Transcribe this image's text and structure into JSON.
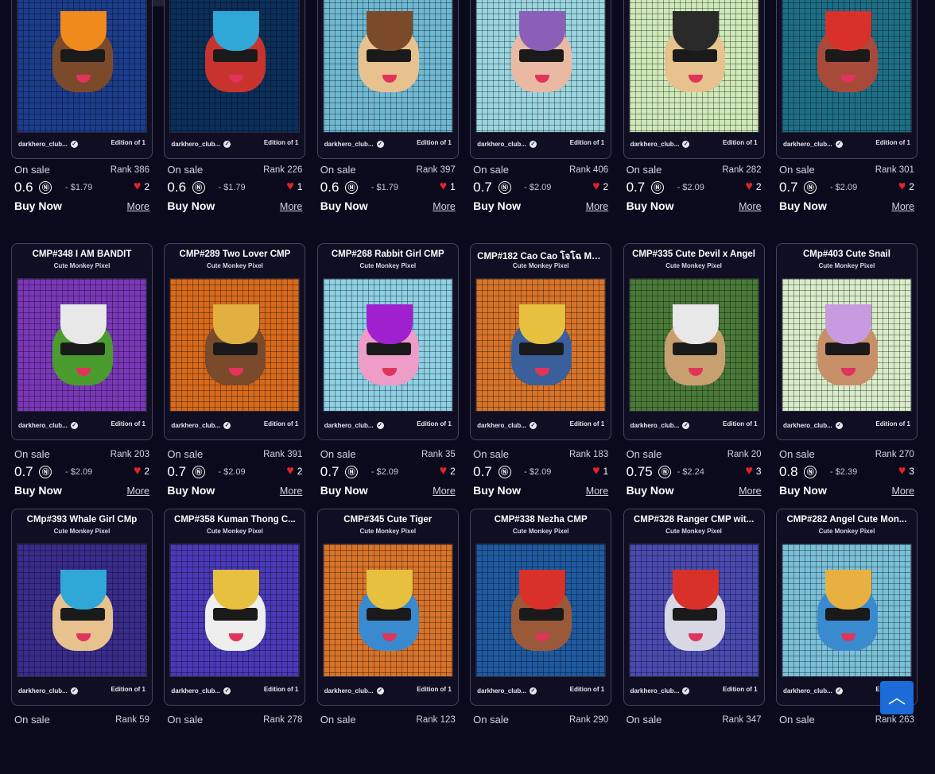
{
  "header": {
    "search_placeholder": "",
    "profile": ""
  },
  "collection_label": "Cute Monkey Pixel",
  "creator": "darkhero_club...",
  "edition": "Edition of 1",
  "on_sale_label": "On sale",
  "buy_label": "Buy Now",
  "more_label": "More",
  "currency_symbol": "Ⓝ",
  "rows": [
    [
      {
        "title": "",
        "rank": "Rank 386",
        "price": "0.6",
        "usd": "- $1.79",
        "likes": "2",
        "colors": {
          "bg": "#1c3d8c",
          "face": "#7a4a2a",
          "accent": "#f08a1c"
        }
      },
      {
        "title": "",
        "rank": "Rank 226",
        "price": "0.6",
        "usd": "- $1.79",
        "likes": "1",
        "colors": {
          "bg": "#0c2f5a",
          "face": "#c8332e",
          "accent": "#2fa8d8"
        }
      },
      {
        "title": "",
        "rank": "Rank 397",
        "price": "0.6",
        "usd": "- $1.79",
        "likes": "1",
        "colors": {
          "bg": "#6fb8d2",
          "face": "#e7c28f",
          "accent": "#7a4a2a"
        }
      },
      {
        "title": "",
        "rank": "Rank 406",
        "price": "0.7",
        "usd": "- $2.09",
        "likes": "2",
        "colors": {
          "bg": "#9bd6e0",
          "face": "#e9b9a4",
          "accent": "#8b5fb8"
        }
      },
      {
        "title": "",
        "rank": "Rank 282",
        "price": "0.7",
        "usd": "- $2.09",
        "likes": "2",
        "colors": {
          "bg": "#cfe9b8",
          "face": "#e7c28f",
          "accent": "#2a2a2a"
        }
      },
      {
        "title": "",
        "rank": "Rank 301",
        "price": "0.7",
        "usd": "- $2.09",
        "likes": "2",
        "colors": {
          "bg": "#1e6f86",
          "face": "#a84a3a",
          "accent": "#d8312a"
        }
      }
    ],
    [
      {
        "title": "CMP#348 I AM BANDIT",
        "rank": "Rank 203",
        "price": "0.7",
        "usd": "- $2.09",
        "likes": "2",
        "colors": {
          "bg": "#7a38b8",
          "face": "#4a9c2e",
          "accent": "#e8e8e8"
        }
      },
      {
        "title": "CMP#289 Two Lover CMP",
        "rank": "Rank 391",
        "price": "0.7",
        "usd": "- $2.09",
        "likes": "2",
        "colors": {
          "bg": "#d86a1c",
          "face": "#7a4a2a",
          "accent": "#e2b040"
        }
      },
      {
        "title": "CMP#268 Rabbit Girl CMP",
        "rank": "Rank 35",
        "price": "0.7",
        "usd": "- $2.09",
        "likes": "2",
        "colors": {
          "bg": "#8ed0e4",
          "face": "#ee9cc8",
          "accent": "#a020d0"
        }
      },
      {
        "title": "CMP#182 Cao Cao โจโฉ Mo...",
        "rank": "Rank 183",
        "price": "0.7",
        "usd": "- $2.09",
        "likes": "1",
        "colors": {
          "bg": "#d8742a",
          "face": "#3a5f9a",
          "accent": "#e8c040"
        }
      },
      {
        "title": "CMP#335 Cute Devil x Angel",
        "rank": "Rank 20",
        "price": "0.75",
        "usd": "- $2.24",
        "likes": "3",
        "colors": {
          "bg": "#4a7a38",
          "face": "#c8a070",
          "accent": "#e8e8e8"
        }
      },
      {
        "title": "CMp#403 Cute Snail",
        "rank": "Rank 270",
        "price": "0.8",
        "usd": "- $2.39",
        "likes": "3",
        "colors": {
          "bg": "#d9ecc9",
          "face": "#c89068",
          "accent": "#c89ae0"
        }
      }
    ],
    [
      {
        "title": "CMp#393 Whale Girl CMp",
        "rank": "Rank 59",
        "price": "",
        "usd": "",
        "likes": "",
        "colors": {
          "bg": "#3a2c8c",
          "face": "#e7c28f",
          "accent": "#2fa8d8"
        }
      },
      {
        "title": "CMP#358 Kuman Thong C...",
        "rank": "Rank 278",
        "price": "",
        "usd": "",
        "likes": "",
        "colors": {
          "bg": "#4a3ab8",
          "face": "#eeeeee",
          "accent": "#e8c040"
        }
      },
      {
        "title": "CMP#345 Cute Tiger",
        "rank": "Rank 123",
        "price": "",
        "usd": "",
        "likes": "",
        "colors": {
          "bg": "#d8742a",
          "face": "#3a8ad0",
          "accent": "#e8c040"
        }
      },
      {
        "title": "CMP#338 Nezha CMP",
        "rank": "Rank 290",
        "price": "",
        "usd": "",
        "likes": "",
        "colors": {
          "bg": "#1f5aa0",
          "face": "#9a5a3a",
          "accent": "#d8312a"
        }
      },
      {
        "title": "CMP#328 Ranger CMP wit...",
        "rank": "Rank 347",
        "price": "",
        "usd": "",
        "likes": "",
        "colors": {
          "bg": "#4a4ab0",
          "face": "#d8d8e4",
          "accent": "#d8312a"
        }
      },
      {
        "title": "CMP#282 Angel Cute Mon...",
        "rank": "Rank 263",
        "price": "",
        "usd": "",
        "likes": "",
        "colors": {
          "bg": "#7ac0d8",
          "face": "#3a8ad0",
          "accent": "#e8b040"
        }
      }
    ]
  ]
}
